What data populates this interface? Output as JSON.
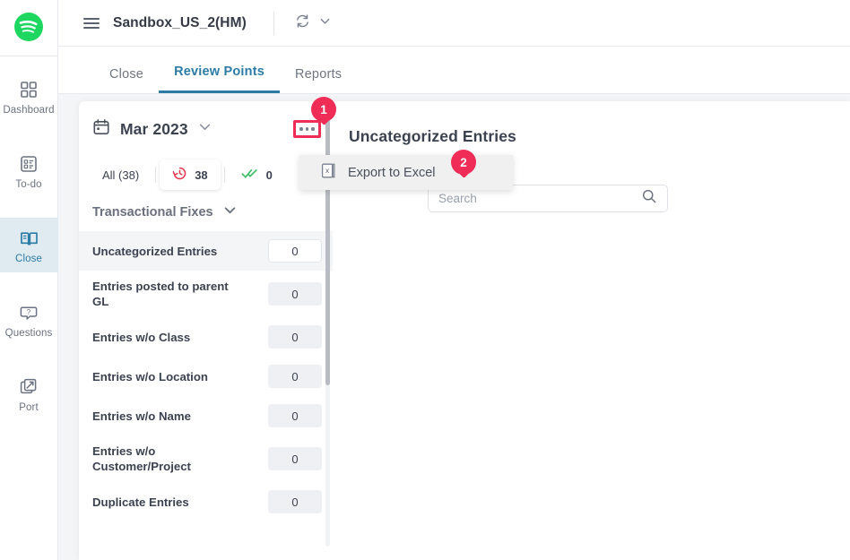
{
  "rail": {
    "logo_icon": "spotify-logo-icon",
    "items": [
      {
        "label": "Dashboard",
        "icon": "grid-icon",
        "active": false
      },
      {
        "label": "To-do",
        "icon": "checklist-icon",
        "active": false
      },
      {
        "label": "Close",
        "icon": "open-book-icon",
        "active": true
      },
      {
        "label": "Questions",
        "icon": "question-bubble-icon",
        "active": false
      },
      {
        "label": "Port",
        "icon": "port-arrow-icon",
        "active": false
      }
    ]
  },
  "topbar": {
    "menu_icon": "hamburger-icon",
    "env_title": "Sandbox_US_2(HM)",
    "refresh_icon": "refresh-sync-icon",
    "chevron_icon": "chevron-down-icon"
  },
  "tabs": [
    {
      "label": "Close",
      "active": false
    },
    {
      "label": "Review Points",
      "active": true
    },
    {
      "label": "Reports",
      "active": false
    }
  ],
  "left_panel": {
    "calendar_icon": "calendar-icon",
    "month": "Mar 2023",
    "month_chevron_icon": "chevron-down-icon",
    "more_button_icon": "ellipsis-icon",
    "chips": [
      {
        "label": "All (38)",
        "count": "",
        "icon": "",
        "selected": false
      },
      {
        "label": "",
        "count": "38",
        "icon": "clock-history-icon",
        "selected": true
      },
      {
        "label": "",
        "count": "0",
        "icon": "double-check-icon",
        "selected": false
      }
    ],
    "group": {
      "title": "Transactional Fixes",
      "chevron_icon": "chevron-down-icon"
    },
    "rows": [
      {
        "label": "Uncategorized Entries",
        "count": "0",
        "selected": true
      },
      {
        "label": "Entries posted to parent GL",
        "count": "0",
        "selected": false
      },
      {
        "label": "Entries w/o Class",
        "count": "0",
        "selected": false
      },
      {
        "label": "Entries w/o Location",
        "count": "0",
        "selected": false
      },
      {
        "label": "Entries w/o Name",
        "count": "0",
        "selected": false
      },
      {
        "label": "Entries w/o Customer/Project",
        "count": "0",
        "selected": false
      },
      {
        "label": "Duplicate Entries",
        "count": "0",
        "selected": false
      }
    ]
  },
  "right_panel": {
    "title": "Uncategorized Entries",
    "search": {
      "placeholder": "Search",
      "value": "",
      "icon": "search-icon"
    }
  },
  "menu": {
    "icon": "excel-file-icon",
    "label": "Export to Excel"
  },
  "badges": [
    {
      "number": "1"
    },
    {
      "number": "2"
    }
  ],
  "colors": {
    "accent_blue": "#2d7ca6",
    "highlight_red": "#ef2d56",
    "spotify_green": "#1ed760",
    "green_check": "#3fbf6a",
    "red_clock": "#e8394f"
  }
}
